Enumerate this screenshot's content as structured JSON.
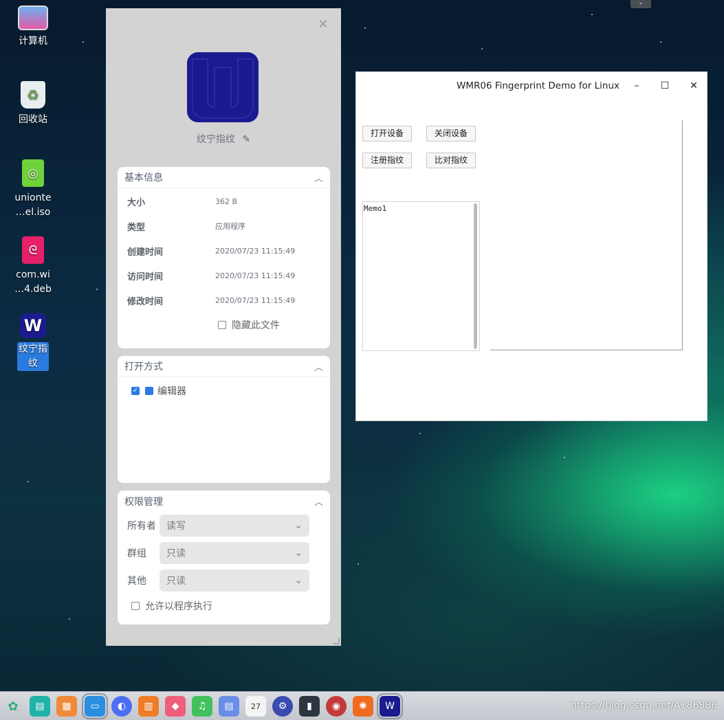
{
  "desktop": {
    "icons": [
      {
        "label": "计算机"
      },
      {
        "label": "回收站"
      },
      {
        "label": "unionte\n…el.iso"
      },
      {
        "label": "com.wi\n…4.deb"
      },
      {
        "label": "纹宁指\n纹"
      }
    ]
  },
  "properties": {
    "file_name": "纹宁指纹",
    "basic": {
      "title": "基本信息",
      "rows": [
        {
          "k": "大小",
          "v": "362 B"
        },
        {
          "k": "类型",
          "v": "应用程序"
        },
        {
          "k": "创建时间",
          "v": "2020/07/23 11:15:49"
        },
        {
          "k": "访问时间",
          "v": "2020/07/23 11:15:49"
        },
        {
          "k": "修改时间",
          "v": "2020/07/23 11:15:49"
        }
      ],
      "hide_label": "隐藏此文件"
    },
    "open_with": {
      "title": "打开方式",
      "app": "编辑器"
    },
    "permissions": {
      "title": "权限管理",
      "rows": [
        {
          "k": "所有者",
          "v": "读写"
        },
        {
          "k": "群组",
          "v": "只读"
        },
        {
          "k": "其他",
          "v": "只读"
        }
      ],
      "exec_label": "允许以程序执行"
    }
  },
  "app": {
    "title": "WMR06 Fingerprint Demo for Linux",
    "buttons": {
      "open": "打开设备",
      "close": "关闭设备",
      "enroll": "注册指纹",
      "match": "比对指纹"
    },
    "memo": "Memo1"
  },
  "taskbar": {
    "calendar_day": "27",
    "watermark": "https://blog.csdn.net/A186886"
  },
  "colors": {
    "accent": "#2a7be0",
    "w_logo": "#1b1b8f"
  }
}
